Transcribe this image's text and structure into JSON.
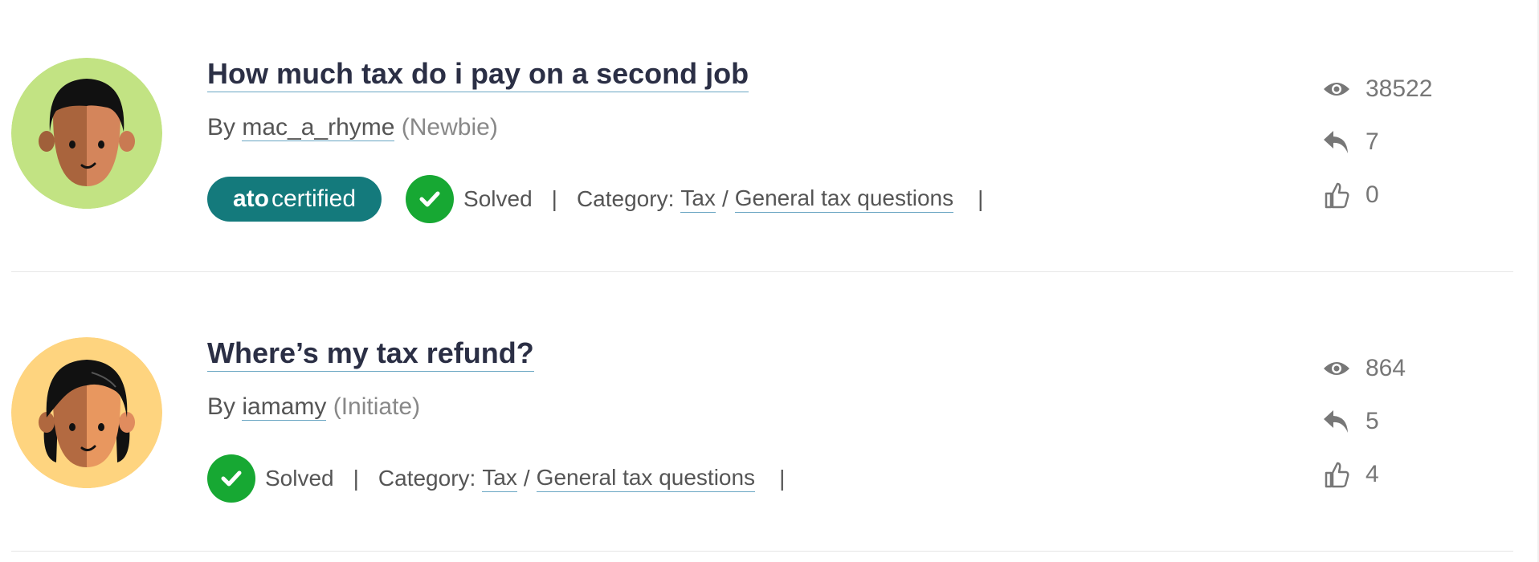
{
  "topics": [
    {
      "title": "How much tax do i pay on a second job",
      "by_label": "By",
      "author": "mac_a_rhyme",
      "rank": "(Newbie)",
      "badge": {
        "bold": "ato",
        "rest": "certified"
      },
      "solved_label": "Solved",
      "separator": "|",
      "category_label": "Category:",
      "category": "Tax",
      "slash": "/",
      "subcategory": "General tax questions",
      "views": "38522",
      "replies": "7",
      "likes": "0",
      "avatar_bg": "#c2e383"
    },
    {
      "title": "Where’s my tax refund?",
      "by_label": "By",
      "author": "iamamy",
      "rank": "(Initiate)",
      "solved_label": "Solved",
      "separator": "|",
      "category_label": "Category:",
      "category": "Tax",
      "slash": "/",
      "subcategory": "General tax questions",
      "views": "864",
      "replies": "5",
      "likes": "4",
      "avatar_bg": "#fed47f"
    }
  ],
  "colors": {
    "title": "#2b2f45",
    "link_underline": "#6aa6c3",
    "badge_bg": "#147a7c",
    "solved_green": "#17a833",
    "stat_text": "#777777"
  },
  "icons": {
    "views": "eye-icon",
    "replies": "reply-arrow-icon",
    "likes": "thumbs-up-icon",
    "solved": "checkmark-icon"
  }
}
